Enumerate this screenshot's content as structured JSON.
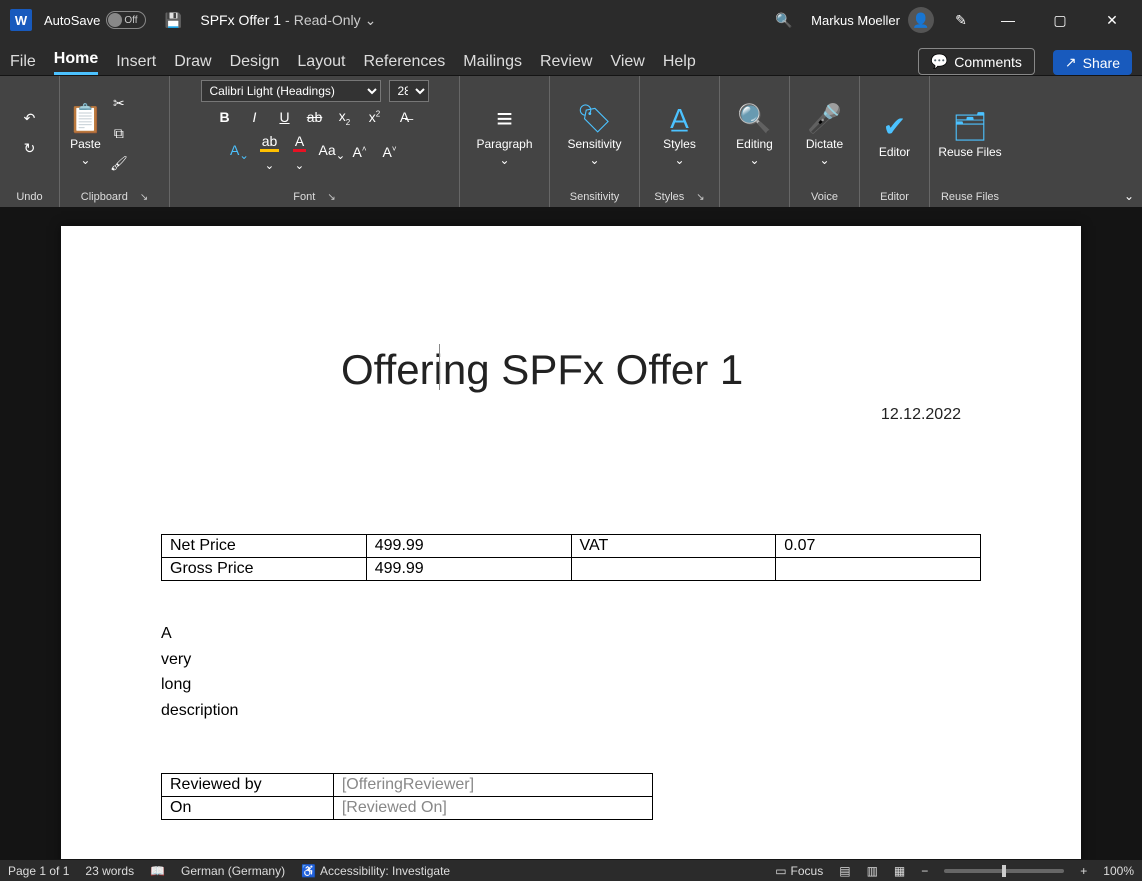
{
  "titlebar": {
    "app_letter": "W",
    "autosave_label": "AutoSave",
    "autosave_state": "Off",
    "doc_name": "SPFx Offer 1",
    "doc_sep": "-",
    "doc_mode": "Read-Only",
    "user_name": "Markus Moeller"
  },
  "tabs": {
    "file": "File",
    "home": "Home",
    "insert": "Insert",
    "draw": "Draw",
    "design": "Design",
    "layout": "Layout",
    "references": "References",
    "mailings": "Mailings",
    "review": "Review",
    "view": "View",
    "help": "Help",
    "comments": "Comments",
    "share": "Share"
  },
  "ribbon": {
    "undo_label": "Undo",
    "clipboard_label": "Clipboard",
    "paste_label": "Paste",
    "font_label": "Font",
    "font_name": "Calibri Light (Headings)",
    "font_size": "28",
    "paragraph_label": "Paragraph",
    "sensitivity_btn": "Sensitivity",
    "sensitivity_label": "Sensitivity",
    "styles_btn": "Styles",
    "styles_label": "Styles",
    "editing_label": "Editing",
    "dictate_label": "Dictate",
    "voice_label": "Voice",
    "editor_label": "Editor",
    "editor_group": "Editor",
    "reuse_label": "Reuse Files",
    "reuse_group": "Reuse Files"
  },
  "document": {
    "heading": "Offering SPFx Offer 1",
    "date": "12.12.2022",
    "table1": {
      "r1c1": "Net Price",
      "r1c2": "499.99",
      "r1c3": "VAT",
      "r1c4": "0.07",
      "r2c1": "Gross Price",
      "r2c2": "499.99",
      "r2c3": "",
      "r2c4": ""
    },
    "desc": {
      "l1": "A",
      "l2": "very",
      "l3": "long",
      "l4": "description"
    },
    "table2": {
      "r1c1": "Reviewed by",
      "r1c2": "[OfferingReviewer]",
      "r2c1": "On",
      "r2c2": "[Reviewed On]"
    }
  },
  "status": {
    "page": "Page 1 of 1",
    "words": "23 words",
    "lang": "German (Germany)",
    "accessibility": "Accessibility: Investigate",
    "focus": "Focus",
    "zoom": "100%"
  }
}
